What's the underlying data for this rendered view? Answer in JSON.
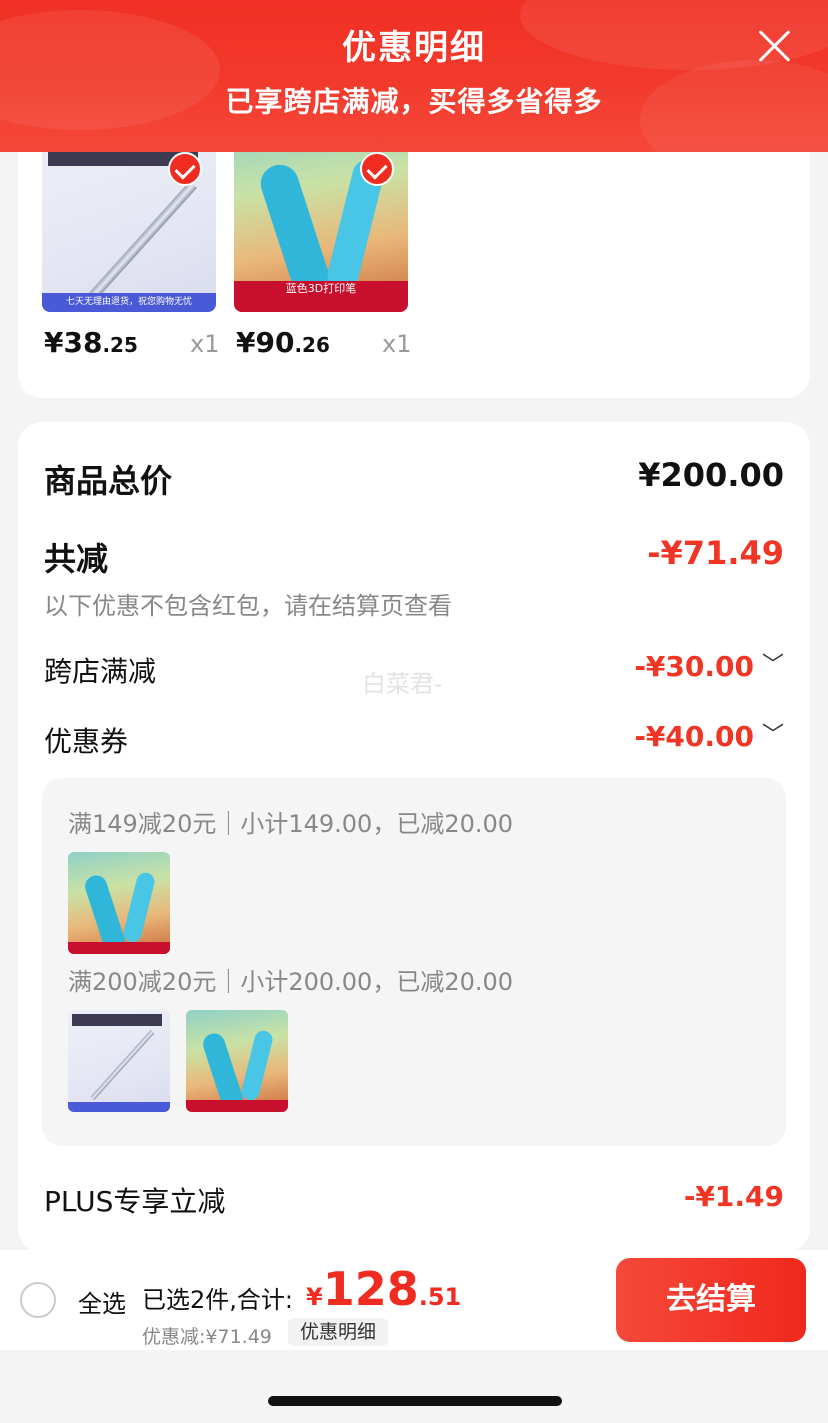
{
  "header": {
    "title": "优惠明细",
    "subtitle": "已享跨店满减，买得多省得多",
    "close_icon": "close-icon"
  },
  "products": [
    {
      "price_int": "¥38",
      "price_dec": ".25",
      "qty": "x1",
      "checked": true,
      "image_label": "七天无理由退货，祝您购物无忧"
    },
    {
      "price_int": "¥90",
      "price_dec": ".26",
      "qty": "x1",
      "checked": true,
      "image_label": "蓝色3D打印笔"
    }
  ],
  "summary": {
    "total_label": "商品总价",
    "total_value": "¥200.00",
    "reduce_label": "共减",
    "reduce_value": "-¥71.49",
    "note": "以下优惠不包含红包，请在结算页查看",
    "watermark": "白菜君-",
    "cross_store_label": "跨店满减",
    "cross_store_value": "-¥30.00",
    "coupon_label": "优惠券",
    "coupon_value": "-¥40.00",
    "plus_label": "PLUS专享立减",
    "plus_value": "-¥1.49"
  },
  "coupons": [
    {
      "line": "满149减20元｜小计149.00，已减20.00"
    },
    {
      "line": "满200减20元｜小计200.00，已减20.00"
    }
  ],
  "bottom": {
    "select_all": "全选",
    "selected_text": "已选2件,合计:",
    "currency": "¥",
    "total_int": "128",
    "total_dec": ".51",
    "discount_text": "优惠减:¥71.49",
    "detail_pill": "优惠明细",
    "checkout": "去结算"
  },
  "colors": {
    "accent_red": "#f02b1f",
    "header_red": "#f23a2c"
  }
}
